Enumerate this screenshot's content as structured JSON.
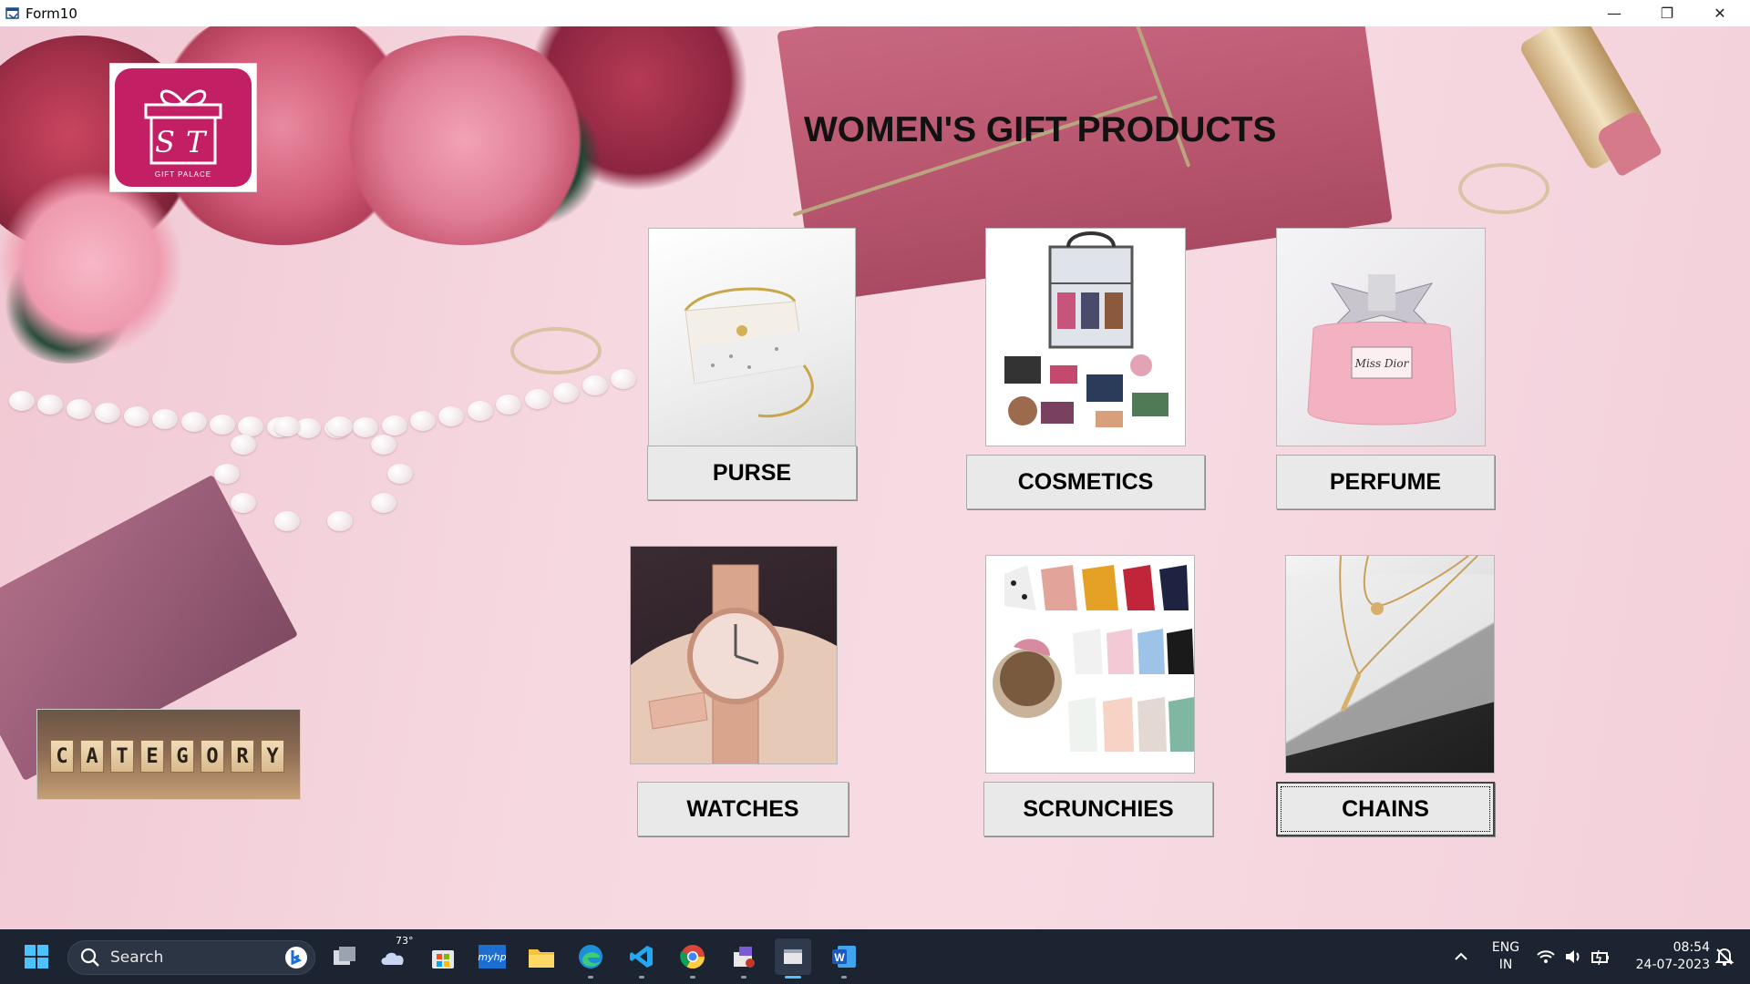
{
  "window": {
    "title": "Form10",
    "minimize_glyph": "—",
    "restore_glyph": "❐",
    "close_glyph": "✕"
  },
  "logo": {
    "icon": "gift-box-icon",
    "brand_text": "GIFT PALACE",
    "monogram": "ST",
    "color": "#c21f64"
  },
  "page_title": "WOMEN'S GIFT PRODUCTS",
  "products": [
    {
      "label": "PURSE",
      "icon": "purse-image"
    },
    {
      "label": "COSMETICS",
      "icon": "cosmetics-image"
    },
    {
      "label": "PERFUME",
      "icon": "perfume-image",
      "bottle_text": "Miss Dior"
    },
    {
      "label": "WATCHES",
      "icon": "watch-image"
    },
    {
      "label": "SCRUNCHIES",
      "icon": "scrunchies-image"
    },
    {
      "label": "CHAINS",
      "icon": "chain-image"
    }
  ],
  "category_image": {
    "letters": [
      "C",
      "A",
      "T",
      "E",
      "G",
      "O",
      "R",
      "Y"
    ]
  },
  "taskbar": {
    "search_placeholder": "Search",
    "weather_temp": "73°",
    "language": "ENG",
    "region": "IN",
    "time": "08:54",
    "date": "24-07-2023",
    "apps": [
      "start-icon",
      "search-icon",
      "task-view-icon",
      "weather-icon",
      "store-icon",
      "myhp-icon",
      "file-explorer-icon",
      "edge-icon",
      "vscode-icon",
      "chrome-icon",
      "visual-studio-app-icon",
      "active-form-app-icon",
      "word-icon"
    ]
  }
}
